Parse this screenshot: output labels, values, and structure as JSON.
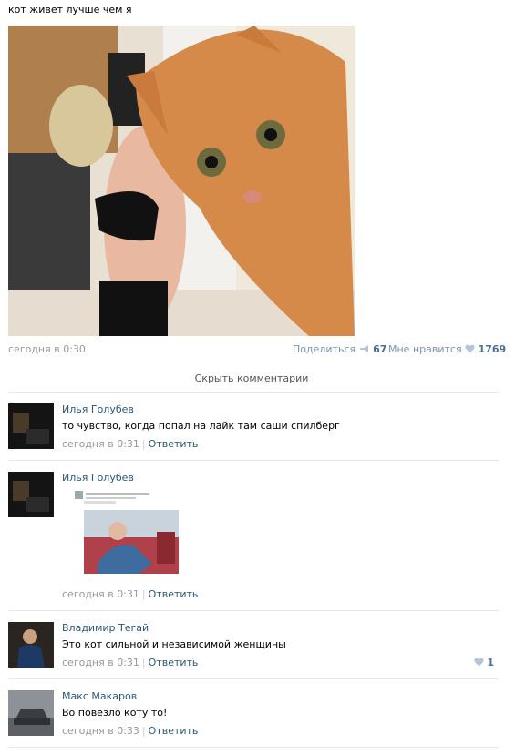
{
  "post": {
    "text": "кот живет лучше чем я",
    "time": "сегодня в 0:30",
    "share_label": "Поделиться",
    "share_count": "67",
    "like_label": "Мне нравится",
    "like_count": "1769",
    "hide_comments": "Скрыть комментарии"
  },
  "comments": [
    {
      "author": "Илья Голубев",
      "text": "то чувство, когда попал на лайк там саши спилберг",
      "time": "сегодня в 0:31",
      "reply": "Ответить"
    },
    {
      "author": "Илья Голубев",
      "text": "",
      "time": "сегодня в 0:31",
      "reply": "Ответить"
    },
    {
      "author": "Владимир Тегай",
      "text": "Это кот сильной и независимой женщины",
      "time": "сегодня в 0:31",
      "reply": "Ответить",
      "likes": "1"
    },
    {
      "author": "Макс Макаров",
      "text": "Во повезло коту то!",
      "time": "сегодня в 0:33",
      "reply": "Ответить"
    }
  ]
}
